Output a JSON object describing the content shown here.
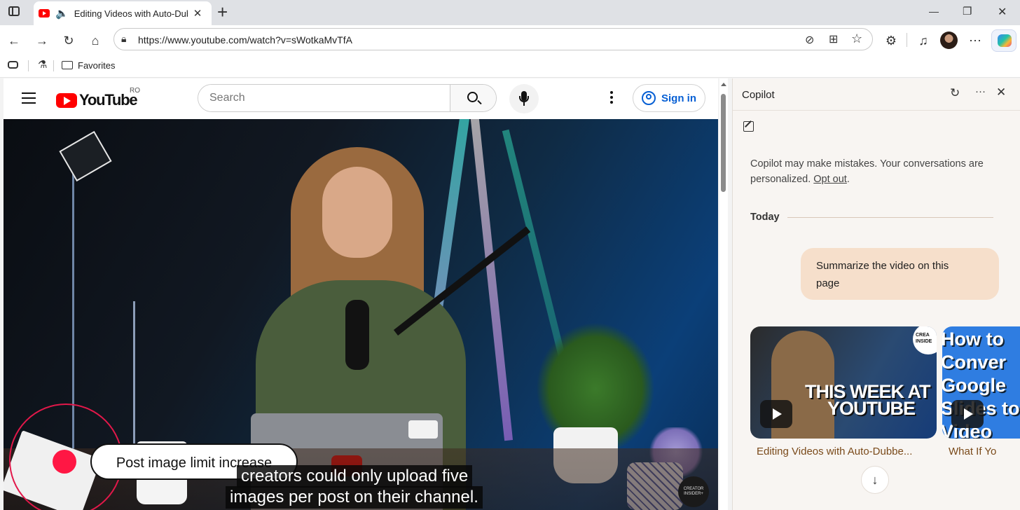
{
  "browser": {
    "tab": {
      "title": "Editing Videos with Auto-Dubbing"
    },
    "new_tab_symbol": "+",
    "window_controls": {
      "minimize": "—",
      "restore": "❐",
      "close": "✕"
    },
    "address": {
      "url": "https://www.youtube.com/watch?v=sWotkaMvTfA"
    },
    "favorites": {
      "label": "Favorites"
    }
  },
  "youtube": {
    "logo_text": "YouTube",
    "region": "RO",
    "search": {
      "placeholder": "Search"
    },
    "sign_in": "Sign in",
    "video": {
      "overlay_label": "Post image limit increase",
      "caption_line1": "creators could only upload five",
      "caption_line2": "images per post on their channel.",
      "watermark": "CREATOR INSIDER+"
    }
  },
  "copilot": {
    "title": "Copilot",
    "notice": "Copilot may make mistakes. Your conversations are personalized.",
    "opt_out": "Opt out",
    "notice_end": ".",
    "date_label": "Today",
    "user_message": "Summarize the video on this page",
    "cards": [
      {
        "thumb_text_line1": "THIS WEEK AT",
        "thumb_text_line2": "YOUTUBE",
        "badge": "CREA INSIDE",
        "caption": "Editing Videos with Auto-Dubbe..."
      },
      {
        "thumb_text": "How to Conver Google Slides to Video",
        "caption": "What If Yo"
      }
    ]
  },
  "colors": {
    "youtube_red": "#ff0000",
    "sign_in_blue": "#065fd4",
    "user_bubble": "#f6dfcb",
    "copilot_bg": "#f8f5f2"
  }
}
